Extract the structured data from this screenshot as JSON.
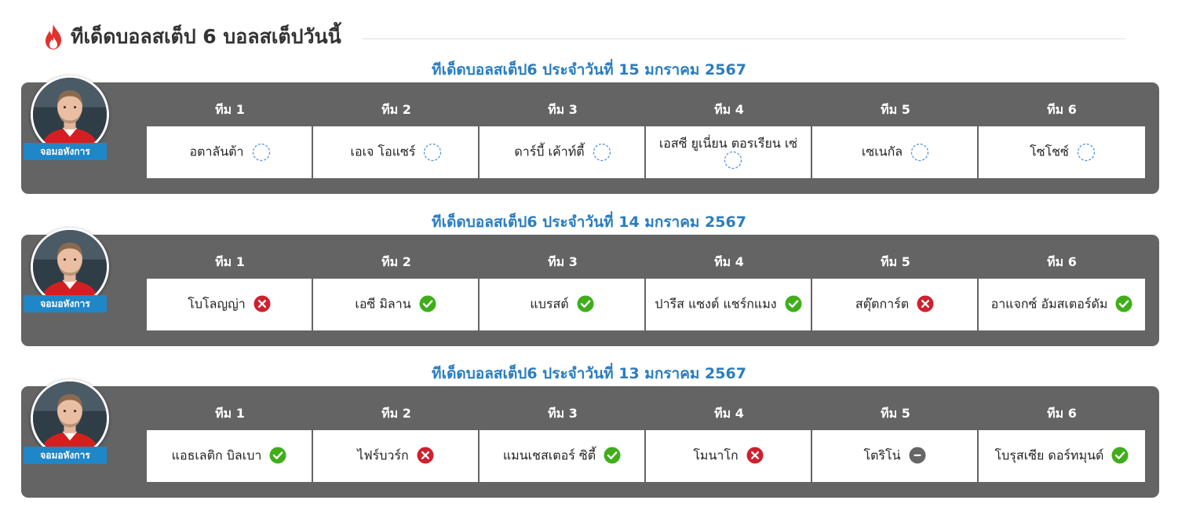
{
  "page": {
    "title": "ทีเด็ดบอลสเต็ป 6 บอลสเต็ปวันนี้"
  },
  "labels": {
    "author": "จอมอหังการ"
  },
  "colors": {
    "accent": "#2a7dc0",
    "card": "#646464",
    "win": "#3fae1a",
    "lose": "#d0202f",
    "draw": "#666666",
    "pending": "#4a90d9"
  },
  "sections": [
    {
      "title": "ทีเด็ดบอลสเต็ป6 ประจำวันที่ 15 มกราคม 2567",
      "headers": [
        "ทีม 1",
        "ทีม 2",
        "ทีม 3",
        "ทีม 4",
        "ทีม 5",
        "ทีม 6"
      ],
      "picks": [
        {
          "team": "อตาลันต้า",
          "status": "pending"
        },
        {
          "team": "เอเจ โอแซร์",
          "status": "pending"
        },
        {
          "team": "ดาร์บี้ เค้าท์ตี้",
          "status": "pending"
        },
        {
          "team": "เอสซี ยูเนี่ยน ตอรเรียน เซ่",
          "status": "pending"
        },
        {
          "team": "เซเนกัล",
          "status": "pending"
        },
        {
          "team": "โซโชซ์",
          "status": "pending"
        }
      ]
    },
    {
      "title": "ทีเด็ดบอลสเต็ป6 ประจำวันที่ 14 มกราคม 2567",
      "headers": [
        "ทีม 1",
        "ทีม 2",
        "ทีม 3",
        "ทีม 4",
        "ทีม 5",
        "ทีม 6"
      ],
      "picks": [
        {
          "team": "โบโลญญ่า",
          "status": "lose"
        },
        {
          "team": "เอซี มิลาน",
          "status": "win"
        },
        {
          "team": "แบรสต์",
          "status": "win"
        },
        {
          "team": "ปารีส แซงต์ แชร์กแมง",
          "status": "win"
        },
        {
          "team": "สตุ๊ตการ์ต",
          "status": "lose"
        },
        {
          "team": "อาแจกซ์ อัมสเตอร์ดัม",
          "status": "win"
        }
      ]
    },
    {
      "title": "ทีเด็ดบอลสเต็ป6 ประจำวันที่ 13 มกราคม 2567",
      "headers": [
        "ทีม 1",
        "ทีม 2",
        "ทีม 3",
        "ทีม 4",
        "ทีม 5",
        "ทีม 6"
      ],
      "picks": [
        {
          "team": "แอธเลติก บิลเบา",
          "status": "win"
        },
        {
          "team": "ไฟร์บวร์ก",
          "status": "lose"
        },
        {
          "team": "แมนเชสเตอร์ ซิตี้",
          "status": "win"
        },
        {
          "team": "โมนาโก",
          "status": "lose"
        },
        {
          "team": "โตริโน่",
          "status": "draw"
        },
        {
          "team": "โบรุสเซีย ดอร์ทมุนด์",
          "status": "win"
        }
      ]
    }
  ]
}
